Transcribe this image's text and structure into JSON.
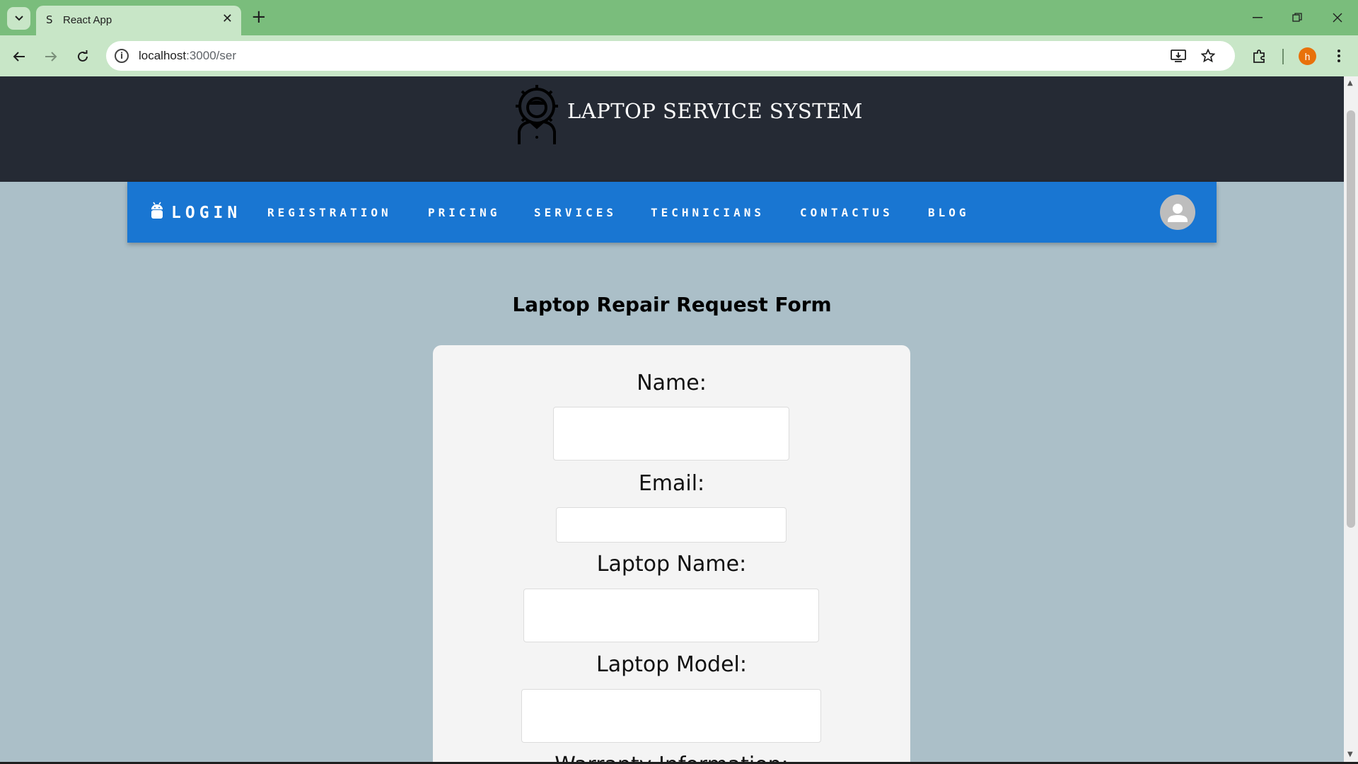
{
  "browser": {
    "tab_title": "React App",
    "tab_favicon": "S",
    "url_host": "localhost",
    "url_path": ":3000/ser",
    "profile_initial": "h",
    "icons": [
      "tab-search-icon",
      "close-icon",
      "new-tab-icon",
      "minimize-icon",
      "restore-icon",
      "window-close-icon",
      "back-icon",
      "forward-icon",
      "reload-icon",
      "site-info-icon",
      "install-app-icon",
      "bookmark-star-icon",
      "extensions-icon",
      "menu-kebab-icon"
    ]
  },
  "header": {
    "title": "LAPTOP SERVICE SYSTEM",
    "logo_icon": "technician-gear-icon"
  },
  "navbar": {
    "brand_icon": "android-icon",
    "brand_label": "LOGIN",
    "items": [
      {
        "label": "REGISTRATION"
      },
      {
        "label": "PRICING"
      },
      {
        "label": "SERVICES"
      },
      {
        "label": "TECHNICIANS"
      },
      {
        "label": "CONTACTUS"
      },
      {
        "label": "BLOG"
      }
    ],
    "user_icon": "user-avatar-icon"
  },
  "form": {
    "heading": "Laptop Repair Request Form",
    "fields": [
      {
        "label": "Name:",
        "value": ""
      },
      {
        "label": "Email:",
        "value": ""
      },
      {
        "label": "Laptop Name:",
        "value": ""
      },
      {
        "label": "Laptop Model:",
        "value": ""
      },
      {
        "label": "Warranty Information:",
        "value": ""
      }
    ]
  },
  "colors": {
    "tabbar": "#7abd7c",
    "toolbar": "#c8e6c7",
    "page_bg": "#abbfc8",
    "header_bg": "#252a34",
    "navbar_bg": "#1976d2",
    "card_bg": "#f4f4f4"
  }
}
